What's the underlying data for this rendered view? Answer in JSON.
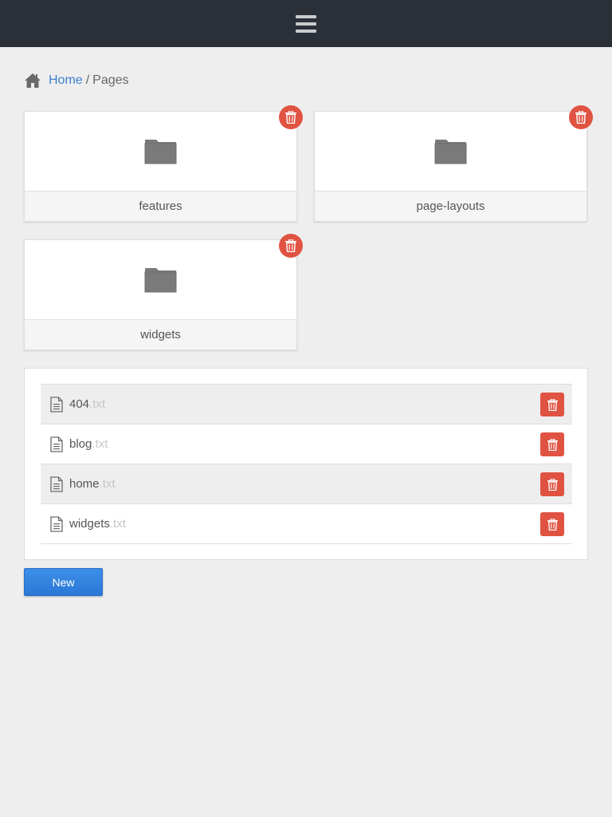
{
  "topbar": {
    "menu_icon": "hamburger-menu-icon",
    "background": "#2b3038"
  },
  "breadcrumb": {
    "home_icon": "home-icon",
    "home_label": "Home",
    "separator": "/",
    "current": "Pages"
  },
  "folders": [
    {
      "name": "features",
      "icon": "folder-icon",
      "delete_icon": "trash-icon"
    },
    {
      "name": "page-layouts",
      "icon": "folder-icon",
      "delete_icon": "trash-icon"
    },
    {
      "name": "widgets",
      "icon": "folder-icon",
      "delete_icon": "trash-icon"
    }
  ],
  "files": [
    {
      "name": "404",
      "ext": ".txt",
      "icon": "file-text-icon",
      "delete_icon": "trash-icon"
    },
    {
      "name": "blog",
      "ext": ".txt",
      "icon": "file-text-icon",
      "delete_icon": "trash-icon"
    },
    {
      "name": "home",
      "ext": ".txt",
      "icon": "file-text-icon",
      "delete_icon": "trash-icon"
    },
    {
      "name": "widgets",
      "ext": ".txt",
      "icon": "file-text-icon",
      "delete_icon": "trash-icon"
    }
  ],
  "actions": {
    "new_label": "New"
  },
  "colors": {
    "accent": "#3d7fd1",
    "danger": "#e05342",
    "primary_button": "#2f82e0"
  }
}
